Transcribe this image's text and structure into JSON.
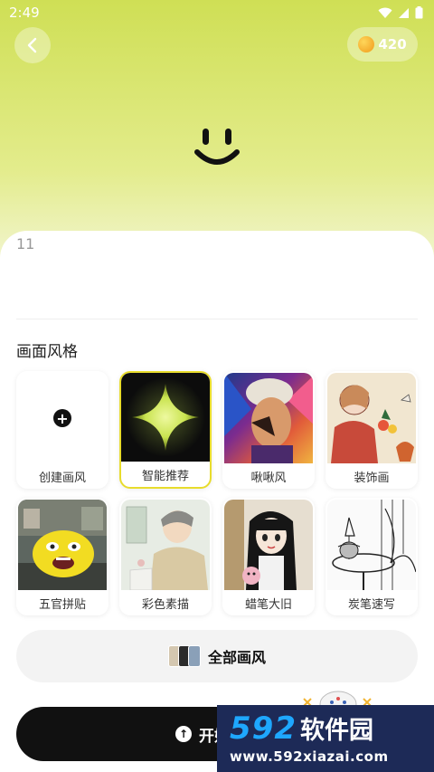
{
  "status_bar": {
    "time": "2:49"
  },
  "header": {
    "coins": "420"
  },
  "prompt": {
    "text": "11"
  },
  "style_section": {
    "title": "画面风格",
    "items": [
      {
        "label": "创建画风"
      },
      {
        "label": "智能推荐"
      },
      {
        "label": "啾啾风"
      },
      {
        "label": "装饰画"
      },
      {
        "label": "五官拼贴"
      },
      {
        "label": "彩色素描"
      },
      {
        "label": "蜡笔大旧"
      },
      {
        "label": "炭笔速写"
      }
    ],
    "selected_index": 1
  },
  "all_styles_button": {
    "label": "全部画风"
  },
  "start_button": {
    "label": "开始"
  },
  "watermark": {
    "number": "592",
    "name": "软件园",
    "url": "www.592xiazai.com"
  },
  "colors": {
    "header_gradient_top": "#cfdf55",
    "selected_border": "#e8dc2c",
    "start_button": "#111111",
    "watermark_bg": "#1d2a57",
    "watermark_accent": "#1ea7ff"
  }
}
